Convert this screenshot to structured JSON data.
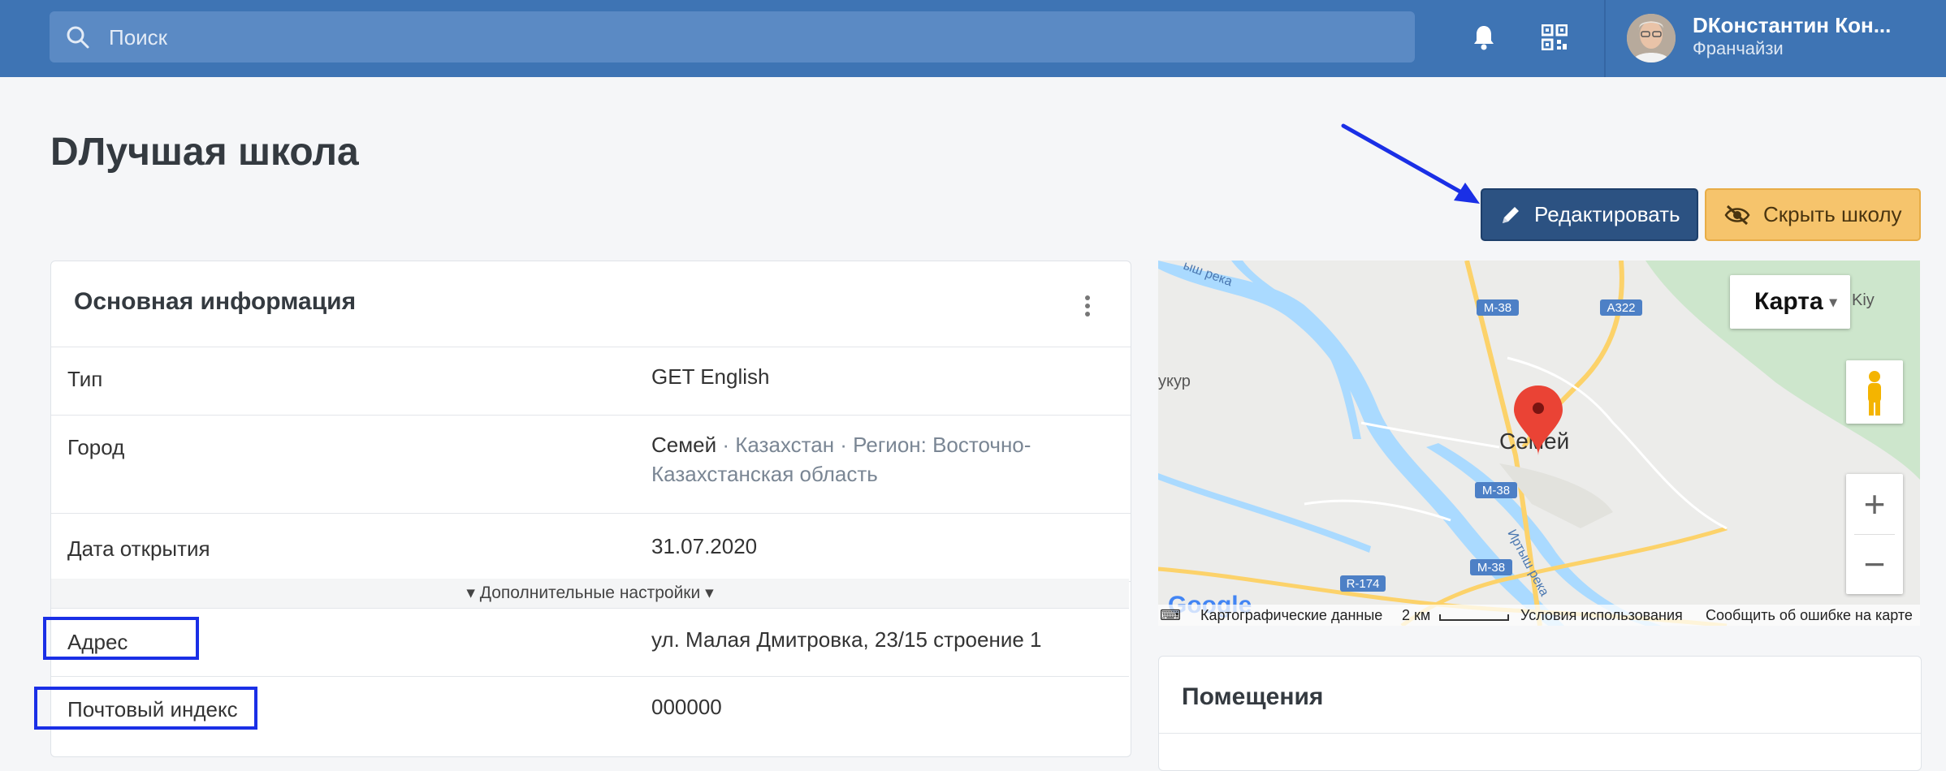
{
  "header": {
    "search_placeholder": "Поиск",
    "user_name": "DКонстантин Кон...",
    "user_role": "Франчайзи"
  },
  "page": {
    "title": "DЛучшая школа",
    "edit_label": "Редактировать",
    "hide_label": "Скрыть школу"
  },
  "info_card": {
    "title": "Основная информация",
    "rows": [
      {
        "label": "Тип",
        "value": "GET English"
      },
      {
        "label": "Город",
        "value": "Семей",
        "value_muted": " · Казахстан · Регион: Восточно-Казахстанская область"
      },
      {
        "label": "Дата открытия",
        "value": "31.07.2020"
      }
    ],
    "extra_toggle": "Дополнительные настройки",
    "extra_rows": [
      {
        "label": "Адрес",
        "value": "ул. Малая Дмитровка, 23/15 строение 1"
      },
      {
        "label": "Почтовый индекс",
        "value": "000000"
      }
    ]
  },
  "map": {
    "type_label": "Карта",
    "city_label": "Семей",
    "place_label": "укур",
    "river_label": "Иртыш река",
    "river_label_top": "ыш река",
    "region_label": "Kiy",
    "roads": [
      "M-38",
      "A322",
      "M-38",
      "M-38",
      "R-174"
    ],
    "google_logo": "Google",
    "footer": {
      "map_data": "Картографические данные",
      "scale": "2 км",
      "terms": "Условия использования",
      "report": "Сообщить об ошибке на карте"
    }
  },
  "rooms_card": {
    "title": "Помещения"
  }
}
